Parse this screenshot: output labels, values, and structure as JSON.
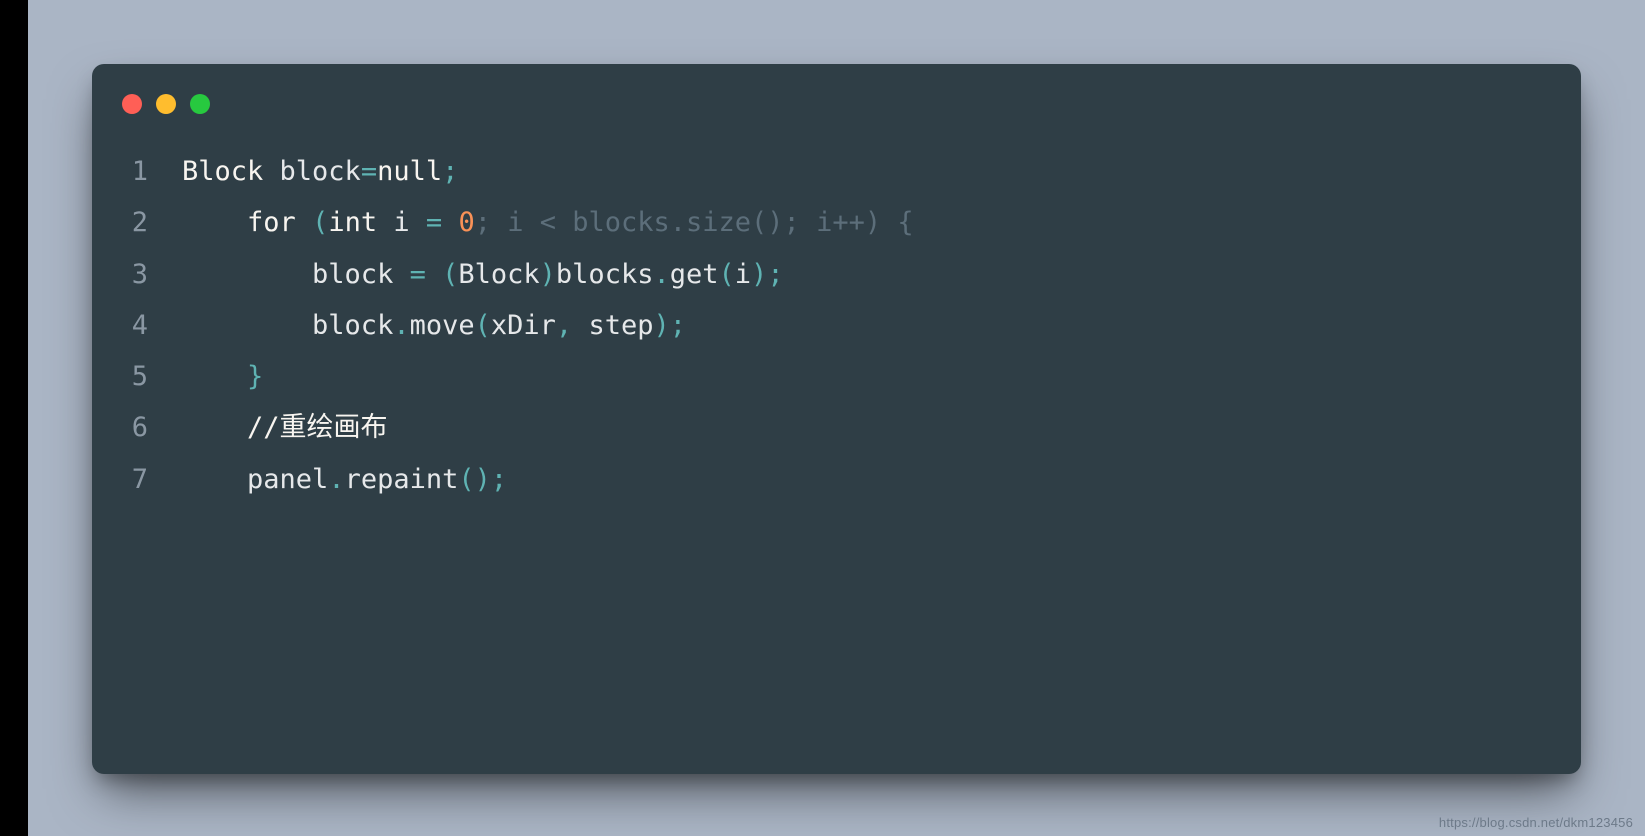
{
  "watermark": "https://blog.csdn.net/dkm123456",
  "lines": [
    {
      "n": "1",
      "tokens": [
        {
          "cls": "kw",
          "t": "Block"
        },
        {
          "cls": "ident",
          "t": " block"
        },
        {
          "cls": "punct",
          "t": "="
        },
        {
          "cls": "kw",
          "t": "null"
        },
        {
          "cls": "punct",
          "t": ";"
        }
      ]
    },
    {
      "n": "2",
      "tokens": [
        {
          "cls": "ident",
          "t": "    "
        },
        {
          "cls": "kw",
          "t": "for"
        },
        {
          "cls": "ident",
          "t": " "
        },
        {
          "cls": "punct",
          "t": "("
        },
        {
          "cls": "kw",
          "t": "int"
        },
        {
          "cls": "ident",
          "t": " i "
        },
        {
          "cls": "punct",
          "t": "="
        },
        {
          "cls": "ident",
          "t": " "
        },
        {
          "cls": "num",
          "t": "0"
        },
        {
          "cls": "muted",
          "t": "; i < blocks.size(); i++) {"
        }
      ]
    },
    {
      "n": "3",
      "tokens": [
        {
          "cls": "ident",
          "t": "        block "
        },
        {
          "cls": "punct",
          "t": "="
        },
        {
          "cls": "ident",
          "t": " "
        },
        {
          "cls": "punct",
          "t": "("
        },
        {
          "cls": "ident",
          "t": "Block"
        },
        {
          "cls": "punct",
          "t": ")"
        },
        {
          "cls": "ident",
          "t": "blocks"
        },
        {
          "cls": "punct",
          "t": "."
        },
        {
          "cls": "ident",
          "t": "get"
        },
        {
          "cls": "punct",
          "t": "("
        },
        {
          "cls": "ident",
          "t": "i"
        },
        {
          "cls": "punct",
          "t": ")"
        },
        {
          "cls": "punct",
          "t": ";"
        }
      ]
    },
    {
      "n": "4",
      "tokens": [
        {
          "cls": "ident",
          "t": "        block"
        },
        {
          "cls": "punct",
          "t": "."
        },
        {
          "cls": "ident",
          "t": "move"
        },
        {
          "cls": "punct",
          "t": "("
        },
        {
          "cls": "ident",
          "t": "xDir"
        },
        {
          "cls": "punct",
          "t": ","
        },
        {
          "cls": "ident",
          "t": " step"
        },
        {
          "cls": "punct",
          "t": ")"
        },
        {
          "cls": "punct",
          "t": ";"
        }
      ]
    },
    {
      "n": "5",
      "tokens": [
        {
          "cls": "ident",
          "t": "    "
        },
        {
          "cls": "punct",
          "t": "}"
        }
      ]
    },
    {
      "n": "6",
      "tokens": [
        {
          "cls": "ident",
          "t": "    "
        },
        {
          "cls": "comment",
          "t": "//重绘画布"
        }
      ]
    },
    {
      "n": "7",
      "tokens": [
        {
          "cls": "ident",
          "t": "    panel"
        },
        {
          "cls": "punct",
          "t": "."
        },
        {
          "cls": "ident",
          "t": "repaint"
        },
        {
          "cls": "punct",
          "t": "()"
        },
        {
          "cls": "punct",
          "t": ";"
        }
      ]
    }
  ]
}
